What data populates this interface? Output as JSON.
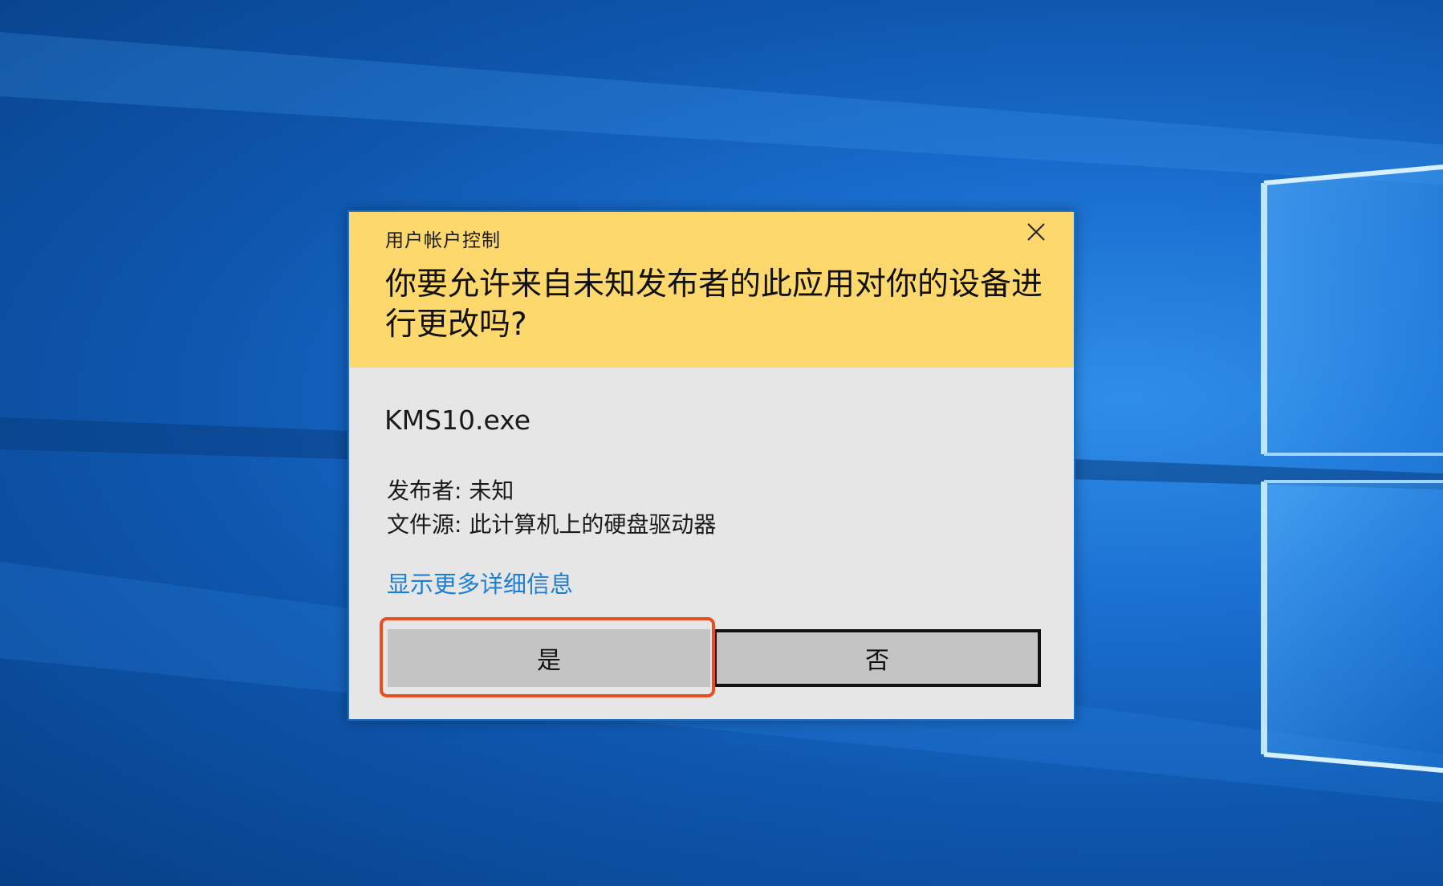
{
  "dialog": {
    "title": "用户帐户控制",
    "question": "你要允许来自未知发布者的此应用对你的设备进行更改吗?",
    "program_name": "KMS10.exe",
    "publisher_label": "发布者:",
    "publisher_value": "未知",
    "source_label": "文件源:",
    "source_value": "此计算机上的硬盘驱动器",
    "details_link": "显示更多详细信息",
    "yes_button": "是",
    "no_button": "否",
    "close_icon": "close-icon"
  },
  "colors": {
    "header_background": "#fdd86c",
    "body_background": "#e6e6e6",
    "link": "#1c7fd6",
    "highlight": "#ea4e1e",
    "desktop": "#0e56ad"
  }
}
